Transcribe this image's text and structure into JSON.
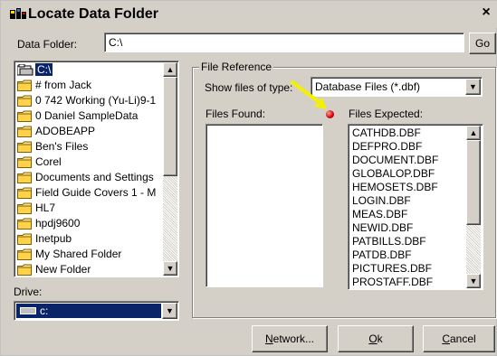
{
  "window": {
    "title": "Locate Data Folder",
    "close_glyph": "×"
  },
  "data_folder": {
    "label": "Data Folder:",
    "value": "C:\\",
    "go_label": "Go"
  },
  "folder_tree": {
    "items": [
      {
        "label": "C:\\",
        "icon": "open-folder-icon",
        "selected": true
      },
      {
        "label": "# from Jack",
        "icon": "folder-icon"
      },
      {
        "label": "0 742 Working (Yu-Li)9-1",
        "icon": "folder-icon"
      },
      {
        "label": "0 Daniel SampleData",
        "icon": "folder-icon"
      },
      {
        "label": "ADOBEAPP",
        "icon": "folder-icon"
      },
      {
        "label": "Ben's Files",
        "icon": "folder-icon"
      },
      {
        "label": "Corel",
        "icon": "folder-icon"
      },
      {
        "label": "Documents and Settings",
        "icon": "folder-icon"
      },
      {
        "label": "Field Guide Covers 1 - M",
        "icon": "folder-icon"
      },
      {
        "label": "HL7",
        "icon": "folder-icon"
      },
      {
        "label": "hpdj9600",
        "icon": "folder-icon"
      },
      {
        "label": "Inetpub",
        "icon": "folder-icon"
      },
      {
        "label": "My Shared Folder",
        "icon": "folder-icon"
      },
      {
        "label": "New Folder",
        "icon": "folder-icon"
      }
    ]
  },
  "drive": {
    "label": "Drive:",
    "value": "c:"
  },
  "file_reference": {
    "group_title": "File Reference",
    "show_files_label": "Show files of type:",
    "file_type_value": "Database Files (*.dbf)",
    "files_found_label": "Files Found:",
    "files_expected_label": "Files Expected:",
    "status_color": "#d00000",
    "arrow_color": "#f5f000",
    "files_expected": [
      "CATHDB.DBF",
      "DEFPRO.DBF",
      "DOCUMENT.DBF",
      "GLOBALOP.DBF",
      "HEMOSETS.DBF",
      "LOGIN.DBF",
      "MEAS.DBF",
      "NEWID.DBF",
      "PATBILLS.DBF",
      "PATDB.DBF",
      "PICTURES.DBF",
      "PROSTAFF.DBF"
    ]
  },
  "buttons": {
    "network_accel": "N",
    "network_rest": "etwork...",
    "ok_accel": "O",
    "ok_rest": "k",
    "cancel_accel": "C",
    "cancel_rest": "ancel"
  }
}
